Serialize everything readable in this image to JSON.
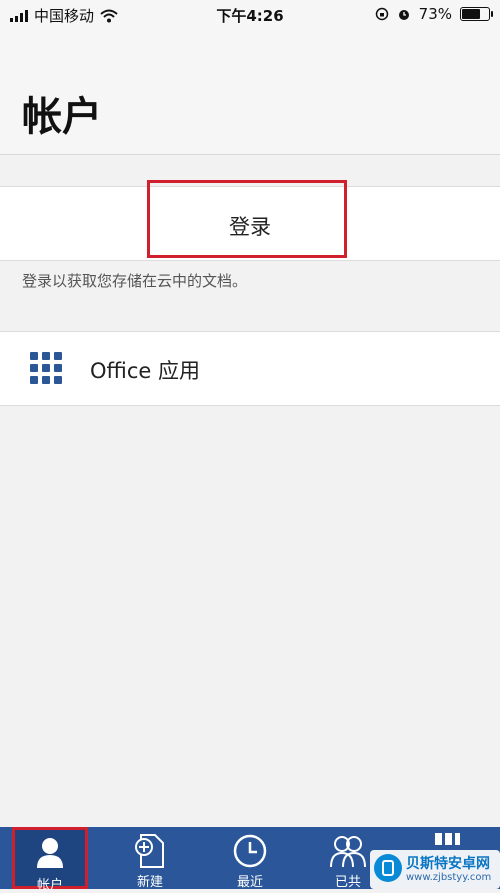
{
  "status_bar": {
    "carrier": "中国移动",
    "time": "下午4:26",
    "battery_percent": "73%",
    "battery_level": 0.73
  },
  "header": {
    "title": "帐户"
  },
  "login": {
    "label": "登录",
    "hint": "登录以获取您存储在云中的文档。"
  },
  "office_apps": {
    "label": "Office 应用"
  },
  "tabbar": {
    "tabs": [
      {
        "label": "帐户"
      },
      {
        "label": "新建"
      },
      {
        "label": "最近"
      },
      {
        "label": "已共"
      }
    ]
  },
  "watermark": {
    "title": "贝斯特安卓网",
    "url": "www.zjbstyy.com"
  },
  "colors": {
    "accent": "#2b579a",
    "highlight": "#d0202e",
    "icon_blue": "#2b5797"
  }
}
